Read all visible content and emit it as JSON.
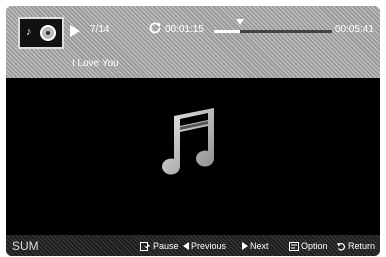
{
  "player": {
    "track_counter": "7/14",
    "elapsed_time": "00:01:15",
    "total_time": "00:05:41",
    "progress_fraction": 0.22,
    "song_title": "I Love You"
  },
  "footer": {
    "source_label": "SUM",
    "controls": [
      {
        "label": "Pause",
        "icon": "pause-enter-icon"
      },
      {
        "label": "Previous",
        "icon": "previous-arrow-icon"
      },
      {
        "label": "Next",
        "icon": "next-arrow-icon"
      },
      {
        "label": "Option",
        "icon": "option-icon"
      },
      {
        "label": "Return",
        "icon": "return-icon"
      }
    ]
  }
}
